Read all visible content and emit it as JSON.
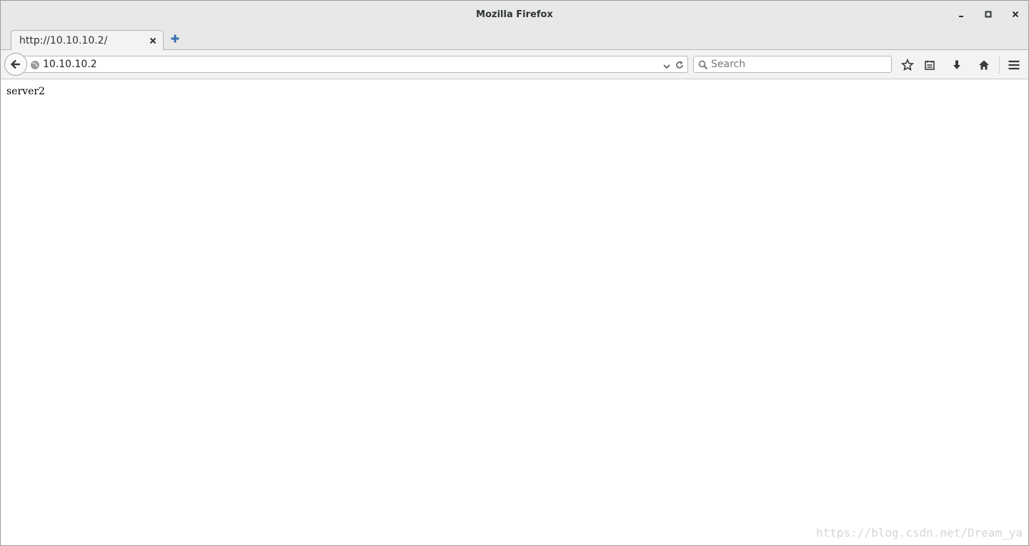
{
  "window": {
    "title": "Mozilla Firefox",
    "controls": {
      "minimize": "minimize-icon",
      "maximize": "maximize-icon",
      "close": "close-icon"
    }
  },
  "tabs": [
    {
      "title": "http://10.10.10.2/",
      "active": true
    }
  ],
  "navbar": {
    "url": "10.10.10.2",
    "search_placeholder": "Search",
    "icons": [
      "back-arrow-icon",
      "globe-icon",
      "dropdown-chevron-icon",
      "reload-icon",
      "search-icon",
      "bookmark-star-icon",
      "reading-list-icon",
      "download-icon",
      "home-icon",
      "menu-icon"
    ]
  },
  "content": {
    "text": "server2"
  },
  "watermark": "https://blog.csdn.net/Dream_ya",
  "colors": {
    "chrome": "#e8e8e8",
    "toolbar": "#f3f3f3",
    "newtab_blue": "#3c6fae"
  }
}
